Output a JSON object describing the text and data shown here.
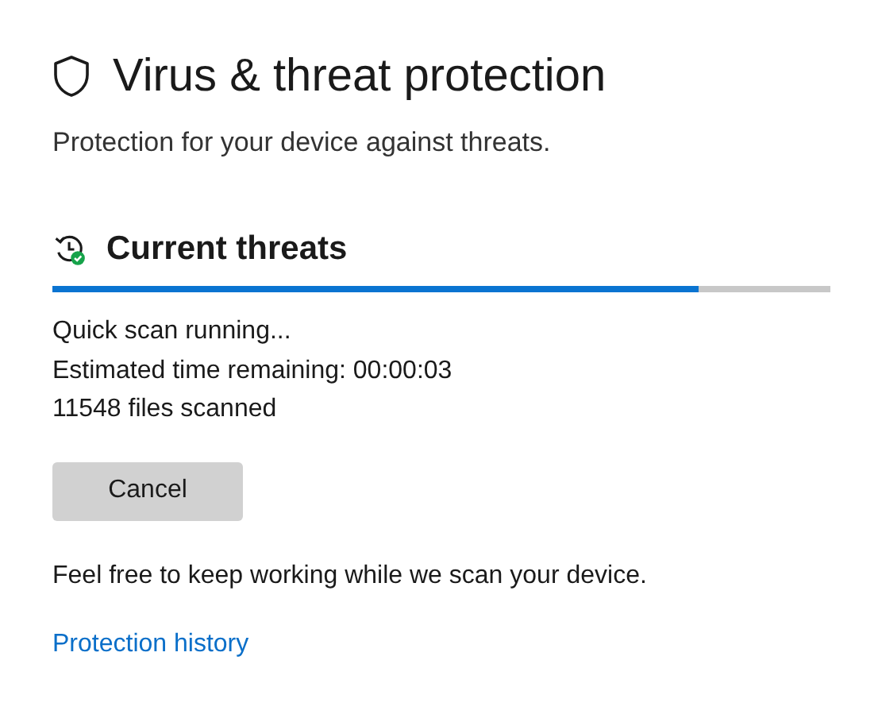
{
  "title": "Virus & threat protection",
  "subtitle": "Protection for your device against threats.",
  "section": {
    "heading": "Current threats",
    "scan_progress": {
      "level": 0.83
    }
  },
  "status_lines": [
    "Quick scan running...",
    "Estimated time remaining: 00:00:03",
    "11548 files scanned"
  ],
  "cancel_button": "Cancel",
  "note": "Feel free to keep working while we scan your device.",
  "link": "Protection history"
}
